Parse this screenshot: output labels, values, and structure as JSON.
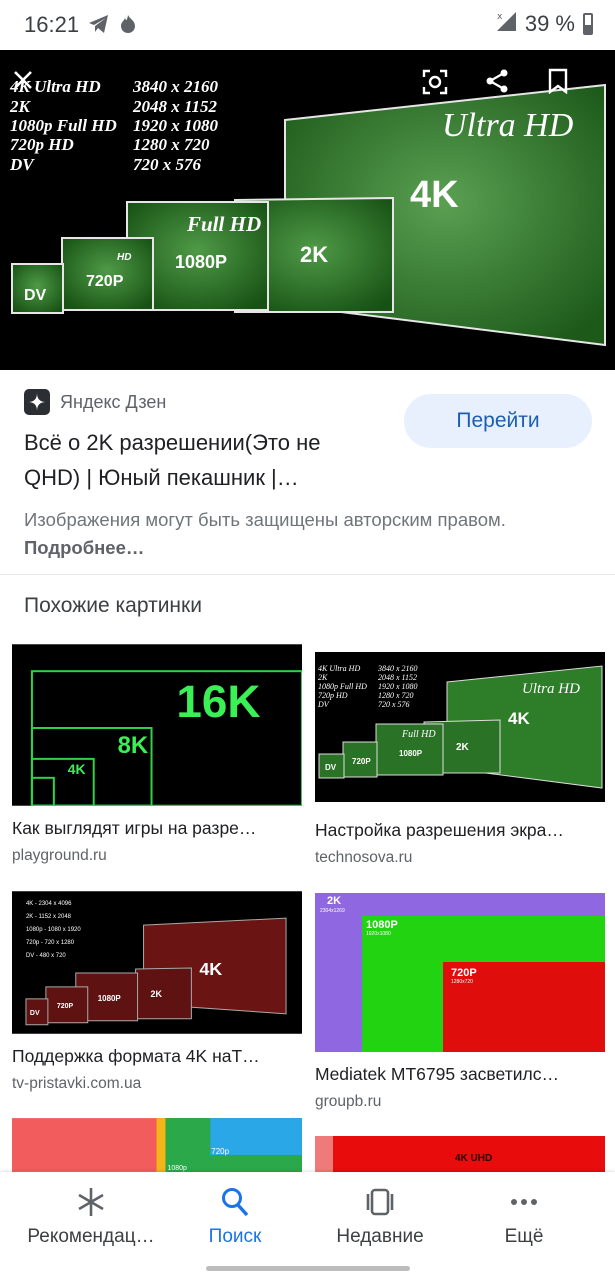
{
  "status_bar": {
    "time": "16:21",
    "battery": "39 %",
    "left_icons": [
      "telegram-icon",
      "fire-icon"
    ],
    "right_icons": [
      "signal-icon",
      "battery-icon"
    ]
  },
  "hero": {
    "resolutions": [
      {
        "name": "4K Ultra HD",
        "size": "3840 x 2160"
      },
      {
        "name": "2K",
        "size": "2048 x 1152"
      },
      {
        "name": "1080p Full HD",
        "size": "1920 x 1080"
      },
      {
        "name": "720p HD",
        "size": "1280 x 720"
      },
      {
        "name": "DV",
        "size": "720 x 576"
      }
    ],
    "box_labels": {
      "uhd_title": "Ultra HD",
      "uhd": "4K",
      "k2": "2K",
      "fhd_title": "Full HD",
      "fhd": "1080P",
      "hd_title": "HD",
      "hd": "720P",
      "dv": "DV"
    },
    "buttons": [
      "close-icon",
      "lens-icon",
      "share-icon",
      "bookmark-icon"
    ]
  },
  "result": {
    "source": "Яндекс Дзен",
    "title_line1": "Всё о 2K разрешении(Это не",
    "title_line2": "QHD) | Юный пекашник |…",
    "goto_label": "Перейти",
    "copyright_text": "Изображения могут быть защищены авторским правом.",
    "more_link": "Подробнее…"
  },
  "similar": {
    "heading": "Похожие картинки",
    "items": [
      {
        "title": "Как выглядят игры на разре…",
        "source": "playground.ru",
        "labels": [
          "16K",
          "8K",
          "4K"
        ]
      },
      {
        "title": "Настройка разрешения экра…",
        "source": "technosova.ru"
      },
      {
        "title": "Поддержка формата 4K наТ…",
        "source": "tv-pristavki.com.ua",
        "list": [
          "4K  - 2304 x 4096",
          "2K  - 1152 x 2048",
          "1080p - 1080 x 1920",
          "720p - 720 x 1280",
          "DV  - 480 x 720"
        ]
      },
      {
        "title": "Mediatek MT6795 засветилс…",
        "source": "groupb.ru",
        "labels": [
          "2K",
          "2304x1269",
          "1080P",
          "1920x1080",
          "720P",
          "1280x720"
        ]
      },
      {
        "labels": [
          "720p",
          "1080p"
        ]
      },
      {
        "labels": [
          "4K UHD"
        ]
      }
    ]
  },
  "bottom_nav": {
    "items": [
      {
        "label": "Рекомендац…",
        "icon": "asterisk-icon"
      },
      {
        "label": "Поиск",
        "icon": "search-icon"
      },
      {
        "label": "Недавние",
        "icon": "recent-tabs-icon"
      },
      {
        "label": "Ещё",
        "icon": "more-dots-icon"
      }
    ],
    "active_index": 1
  },
  "colors": {
    "accent": "#1a73e8",
    "goto_bg": "#e8f0fe",
    "hero_green": "#2f7a2a"
  }
}
